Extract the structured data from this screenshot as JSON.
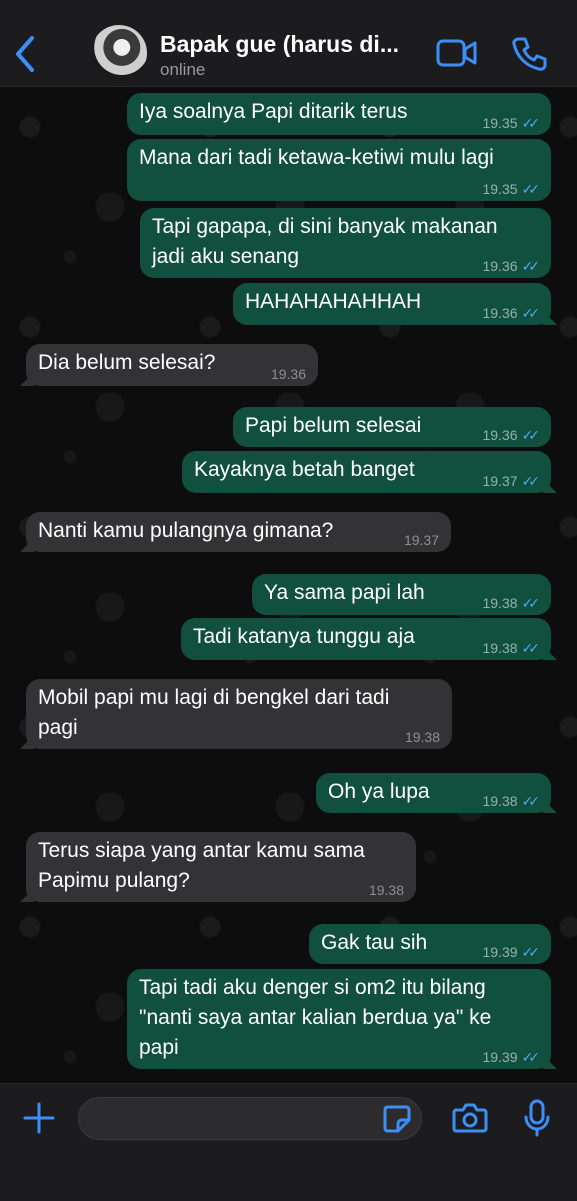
{
  "header": {
    "contact_name": "Bapak gue (harus di...",
    "status": "online"
  },
  "colors": {
    "accent": "#3b8ff6",
    "outgoing_bubble": "#11503f",
    "incoming_bubble": "#333335",
    "read_ticks": "#53a8f3"
  },
  "icons": {
    "back": "chevron-left-icon",
    "video": "video-camera-icon",
    "call": "phone-icon",
    "attach": "plus-icon",
    "sticker": "sticker-icon",
    "camera": "camera-icon",
    "mic": "microphone-icon"
  },
  "messages": [
    {
      "dir": "out",
      "text": "Iya soalnya Papi ditarik terus",
      "time": "19.35",
      "status": "read"
    },
    {
      "dir": "out",
      "text": "Mana dari tadi ketawa-ketiwi mulu lagi",
      "time": "19.35",
      "status": "read"
    },
    {
      "dir": "out",
      "text": "Tapi gapapa, di sini banyak makanan\njadi aku senang",
      "time": "19.36",
      "status": "read"
    },
    {
      "dir": "out",
      "text": "HAHAHAHAHHAH",
      "time": "19.36",
      "status": "read"
    },
    {
      "dir": "in",
      "text": "Dia belum selesai?",
      "time": "19.36"
    },
    {
      "dir": "out",
      "text": "Papi belum selesai",
      "time": "19.36",
      "status": "read"
    },
    {
      "dir": "out",
      "text": "Kayaknya betah banget",
      "time": "19.37",
      "status": "read"
    },
    {
      "dir": "in",
      "text": "Nanti kamu pulangnya gimana?",
      "time": "19.37"
    },
    {
      "dir": "out",
      "text": "Ya sama papi lah",
      "time": "19.38",
      "status": "read"
    },
    {
      "dir": "out",
      "text": "Tadi katanya tunggu aja",
      "time": "19.38",
      "status": "read"
    },
    {
      "dir": "in",
      "text": "Mobil papi mu lagi di bengkel dari tadi\npagi",
      "time": "19.38"
    },
    {
      "dir": "out",
      "text": "Oh ya lupa",
      "time": "19.38",
      "status": "read"
    },
    {
      "dir": "in",
      "text": "Terus siapa yang antar kamu sama\nPapimu pulang?",
      "time": "19.38"
    },
    {
      "dir": "out",
      "text": "Gak tau sih",
      "time": "19.39",
      "status": "read"
    },
    {
      "dir": "out",
      "text": "Tapi tadi aku denger si om2 itu bilang\n\"nanti saya antar kalian berdua ya\" ke\npapi",
      "time": "19.39",
      "status": "read"
    }
  ],
  "composer": {
    "value": "",
    "placeholder": ""
  }
}
